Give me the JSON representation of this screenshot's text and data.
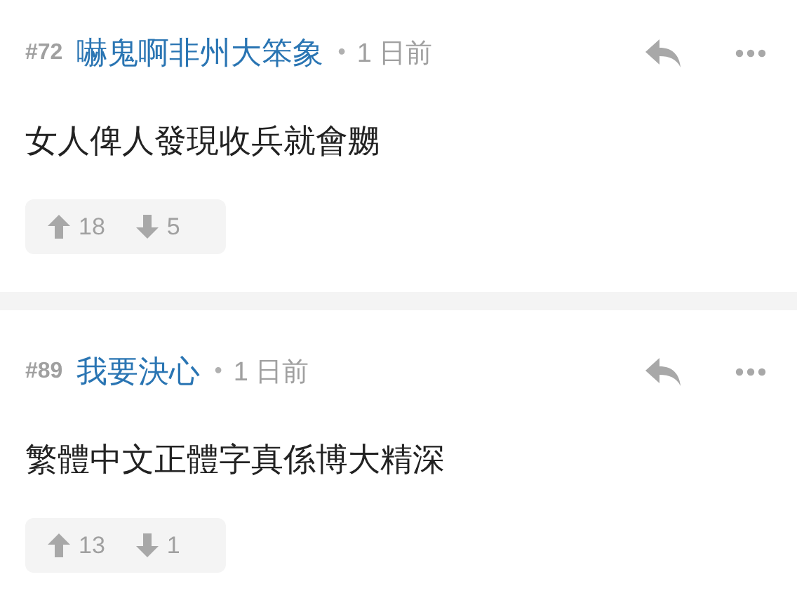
{
  "comments": [
    {
      "number": "#72",
      "author": "嚇鬼啊非州大笨象",
      "separator": "•",
      "time": "1 日前",
      "body": "女人俾人發現收兵就會嬲",
      "upvotes": "18",
      "downvotes": "5"
    },
    {
      "number": "#89",
      "author": "我要決心",
      "separator": "•",
      "time": "1 日前",
      "body": "繁體中文正體字真係博大精深",
      "upvotes": "13",
      "downvotes": "1"
    }
  ]
}
